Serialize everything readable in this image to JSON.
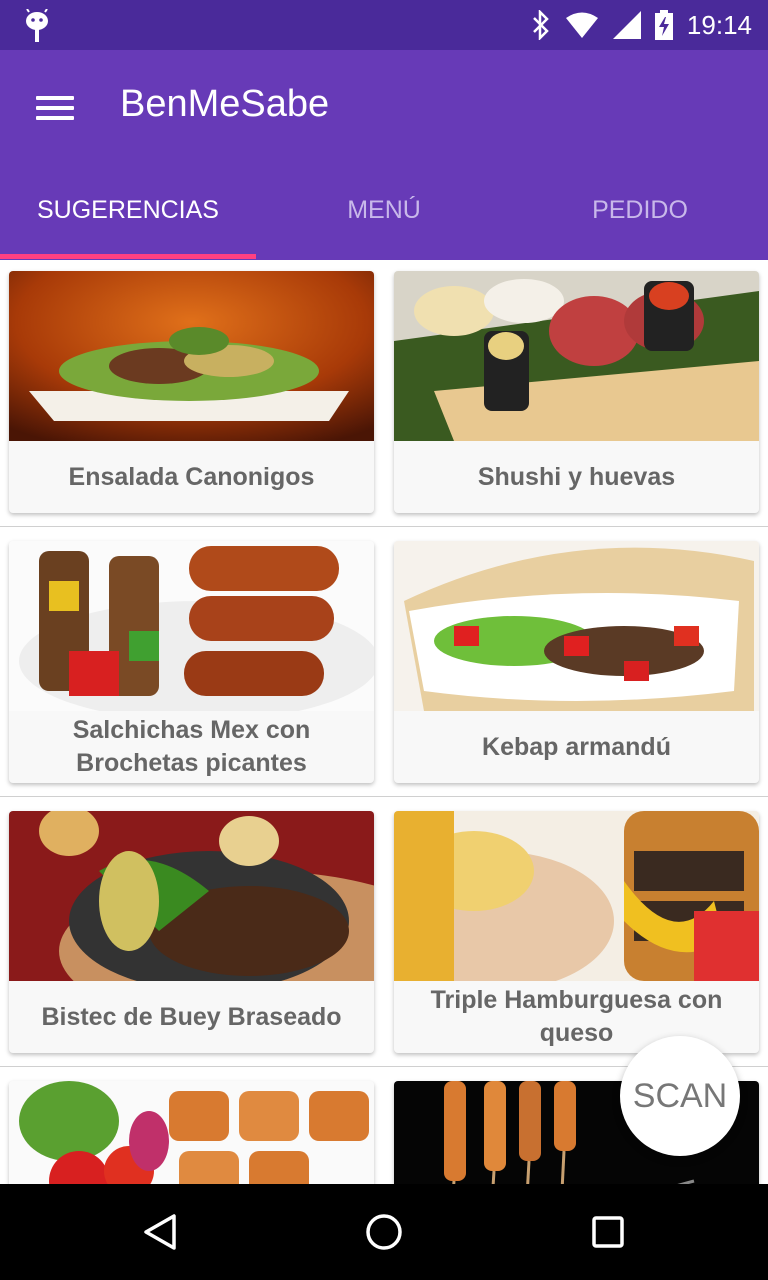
{
  "status_bar": {
    "time": "19:14"
  },
  "app_bar": {
    "title": "BenMeSabe"
  },
  "tabs": [
    {
      "label": "SUGERENCIAS",
      "active": true
    },
    {
      "label": "MENÚ",
      "active": false
    },
    {
      "label": "PEDIDO",
      "active": false
    }
  ],
  "cards": [
    {
      "name": "Ensalada Canonigos"
    },
    {
      "name": "Shushi y huevas"
    },
    {
      "name": "Salchichas Mex con Brochetas picantes"
    },
    {
      "name": "Kebap armandú"
    },
    {
      "name": "Bistec de Buey Braseado"
    },
    {
      "name": "Triple Hamburguesa con queso"
    },
    {
      "name": ""
    },
    {
      "name": ""
    }
  ],
  "fab": {
    "label": "SCAN"
  },
  "colors": {
    "primary": "#673ab7",
    "primary_dark": "#4a2a9a",
    "accent": "#ff4081"
  }
}
